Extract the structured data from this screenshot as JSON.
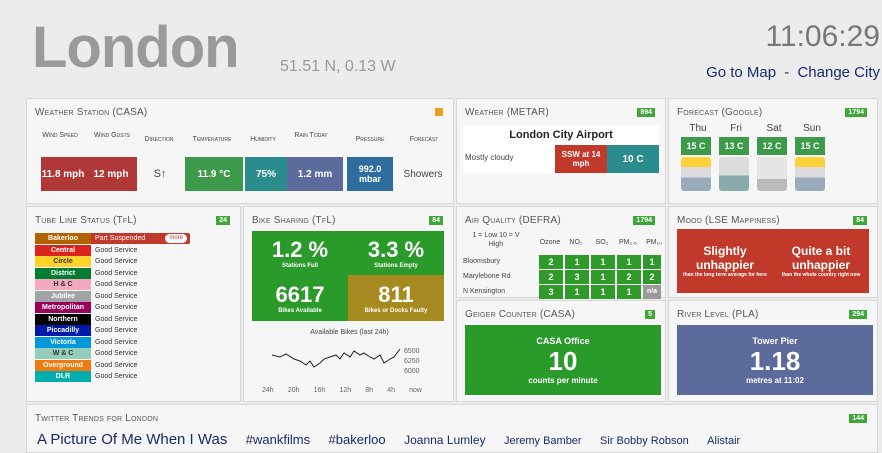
{
  "header": {
    "city": "London",
    "coords": "51.51 N, 0.13 W",
    "time": "11:06:29",
    "go_to_map": "Go to Map",
    "separator": "-",
    "change_city": "Change City"
  },
  "weather_station": {
    "title": "Weather Station (CASA)",
    "headers": [
      "Wind Speed",
      "Wind Gusts",
      "Direction",
      "Temperature",
      "Humidity",
      "Rain Today",
      "Pressure",
      "Forecast"
    ],
    "values": [
      "11.8 mph",
      "12 mph",
      "S↑",
      "11.9 °C",
      "75%",
      "1.2 mm",
      "992.0 mbar",
      "Showers"
    ]
  },
  "metar": {
    "title": "Weather (METAR)",
    "badge": "894",
    "airport": "London City Airport",
    "condition": "Mostly cloudy",
    "wind": "SSW at 14 mph",
    "temp": "10 C"
  },
  "forecast": {
    "title": "Forecast (Google)",
    "badge": "1794",
    "days": [
      {
        "day": "Thu",
        "temp": "15 C"
      },
      {
        "day": "Fri",
        "temp": "13 C"
      },
      {
        "day": "Sat",
        "temp": "12 C"
      },
      {
        "day": "Sun",
        "temp": "15 C"
      }
    ]
  },
  "tube": {
    "title": "Tube Line Status (TfL)",
    "badge": "24",
    "more": "more",
    "lines": [
      {
        "name": "Bakerloo",
        "status": "Part Suspended",
        "color": "#b26300"
      },
      {
        "name": "Central",
        "status": "Good Service",
        "color": "#dc241f"
      },
      {
        "name": "Circle",
        "status": "Good Service",
        "color": "#ffd329"
      },
      {
        "name": "District",
        "status": "Good Service",
        "color": "#007d32"
      },
      {
        "name": "H & C",
        "status": "Good Service",
        "color": "#f4a9be"
      },
      {
        "name": "Jubilee",
        "status": "Good Service",
        "color": "#a1a5a7"
      },
      {
        "name": "Metropolitan",
        "status": "Good Service",
        "color": "#9b0058"
      },
      {
        "name": "Northern",
        "status": "Good Service",
        "color": "#000000"
      },
      {
        "name": "Piccadilly",
        "status": "Good Service",
        "color": "#0019a8"
      },
      {
        "name": "Victoria",
        "status": "Good Service",
        "color": "#0098d8"
      },
      {
        "name": "W & C",
        "status": "Good Service",
        "color": "#93ceba"
      },
      {
        "name": "Overground",
        "status": "Good Service",
        "color": "#ef7b10"
      },
      {
        "name": "DLR",
        "status": "Good Service",
        "color": "#00afad"
      }
    ]
  },
  "bikes": {
    "title": "Bike Sharing (TfL)",
    "badge": "84",
    "full_pct": "1.2 %",
    "full_label": "Stations Full",
    "empty_pct": "3.3 %",
    "empty_label": "Stations Empty",
    "available": "6617",
    "available_label": "Bikes Available",
    "faulty": "811",
    "faulty_label": "Bikes or Docks Faulty",
    "chart_title": "Available Bikes (last 24h)",
    "y_ticks": [
      "6500",
      "6250",
      "6000"
    ],
    "x_ticks": [
      "24h",
      "20h",
      "16h",
      "12h",
      "8h",
      "4h",
      "now"
    ]
  },
  "air": {
    "title": "Air Quality (DEFRA)",
    "badge": "1794",
    "legend": "1 = Low 10 = V High",
    "columns": [
      "Ozone",
      "NO₂",
      "SO₂",
      "PM₂.₅",
      "PM₁₀"
    ],
    "rows": [
      {
        "site": "Bloomsbury",
        "values": [
          "2",
          "1",
          "1",
          "1",
          "1"
        ]
      },
      {
        "site": "Marylebone Rd",
        "values": [
          "2",
          "3",
          "1",
          "2",
          "2"
        ]
      },
      {
        "site": "N Kensington",
        "values": [
          "3",
          "1",
          "1",
          "1",
          "n/a"
        ]
      }
    ]
  },
  "mood": {
    "title": "Mood (LSE Mappiness)",
    "badge": "84",
    "left_big": "Slightly unhappier",
    "left_small": "than the long term average for here",
    "right_big": "Quite a bit unhappier",
    "right_small": "than the whole country right now"
  },
  "geiger": {
    "title": "Geiger Counter (CASA)",
    "badge": "5",
    "location": "CASA Office",
    "value": "10",
    "unit": "counts per minute"
  },
  "river": {
    "title": "River Level (PLA)",
    "badge": "294",
    "location": "Tower Pier",
    "value": "1.18",
    "unit": "metres at 11:02"
  },
  "twitter": {
    "title": "Twitter Trends for London",
    "badge": "144",
    "trends": [
      "A Picture Of Me When I Was",
      "#wankfilms",
      "#bakerloo",
      "Joanna Lumley",
      "Jeremy Bamber",
      "Sir Bobby Robson",
      "Alistair"
    ]
  },
  "colors": {
    "green": "#2f9a2a",
    "red": "#c0392b",
    "teal": "#2a8c8c",
    "slate": "#5c6b9c",
    "olive": "#a68a1f"
  }
}
